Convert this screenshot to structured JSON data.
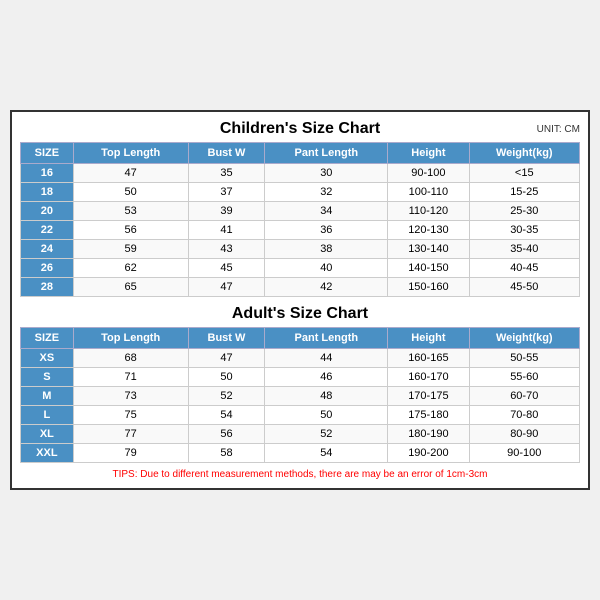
{
  "children_title": "Children's Size Chart",
  "adult_title": "Adult's Size Chart",
  "unit_label": "UNIT: CM",
  "headers": [
    "SIZE",
    "Top Length",
    "Bust W",
    "Pant Length",
    "Height",
    "Weight(kg)"
  ],
  "children_rows": [
    [
      "16",
      "47",
      "35",
      "30",
      "90-100",
      "<15"
    ],
    [
      "18",
      "50",
      "37",
      "32",
      "100-110",
      "15-25"
    ],
    [
      "20",
      "53",
      "39",
      "34",
      "110-120",
      "25-30"
    ],
    [
      "22",
      "56",
      "41",
      "36",
      "120-130",
      "30-35"
    ],
    [
      "24",
      "59",
      "43",
      "38",
      "130-140",
      "35-40"
    ],
    [
      "26",
      "62",
      "45",
      "40",
      "140-150",
      "40-45"
    ],
    [
      "28",
      "65",
      "47",
      "42",
      "150-160",
      "45-50"
    ]
  ],
  "adult_rows": [
    [
      "XS",
      "68",
      "47",
      "44",
      "160-165",
      "50-55"
    ],
    [
      "S",
      "71",
      "50",
      "46",
      "160-170",
      "55-60"
    ],
    [
      "M",
      "73",
      "52",
      "48",
      "170-175",
      "60-70"
    ],
    [
      "L",
      "75",
      "54",
      "50",
      "175-180",
      "70-80"
    ],
    [
      "XL",
      "77",
      "56",
      "52",
      "180-190",
      "80-90"
    ],
    [
      "XXL",
      "79",
      "58",
      "54",
      "190-200",
      "90-100"
    ]
  ],
  "tips": "TIPS: Due to different measurement methods, there are may be an error of 1cm-3cm"
}
